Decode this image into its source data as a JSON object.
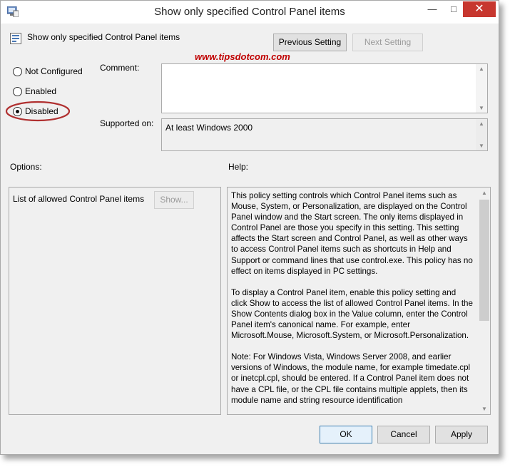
{
  "window": {
    "title": "Show only specified Control Panel items"
  },
  "policy": {
    "name": "Show only specified Control Panel items"
  },
  "nav": {
    "previous": "Previous Setting",
    "next": "Next Setting"
  },
  "watermark": {
    "text": "www.tipsdotcom.com",
    "color": "#c00000"
  },
  "state": {
    "options": [
      "Not Configured",
      "Enabled",
      "Disabled"
    ],
    "selected": "Disabled"
  },
  "comment": {
    "label": "Comment:",
    "value": ""
  },
  "supported": {
    "label": "Supported on:",
    "value": "At least Windows 2000"
  },
  "sections": {
    "options": "Options:",
    "help": "Help:"
  },
  "options_panel": {
    "item_label": "List of allowed Control Panel items",
    "show_button": "Show..."
  },
  "help": {
    "paragraphs": [
      "This policy setting controls which Control Panel items such as Mouse, System, or Personalization, are displayed on the Control Panel window and the Start screen. The only items displayed in Control Panel are those you specify in this setting. This setting affects the Start screen and Control Panel, as well as other ways to access Control Panel items such as shortcuts in Help and Support or command lines that use control.exe. This policy has no effect on items displayed in PC settings.",
      "To display a Control Panel item, enable this policy setting and click Show to access the list of allowed Control Panel items. In the Show Contents dialog box in the Value column, enter the Control Panel item's canonical name. For example, enter Microsoft.Mouse, Microsoft.System, or Microsoft.Personalization.",
      "Note: For Windows Vista, Windows Server 2008, and earlier versions of Windows, the module name, for example timedate.cpl or inetcpl.cpl, should be entered. If a Control Panel item does not have a CPL file, or the CPL file contains multiple applets, then its module name and string resource identification"
    ]
  },
  "buttons": {
    "ok": "OK",
    "cancel": "Cancel",
    "apply": "Apply"
  },
  "colors": {
    "highlight_ring": "#b03030",
    "close_button": "#c7372f"
  }
}
